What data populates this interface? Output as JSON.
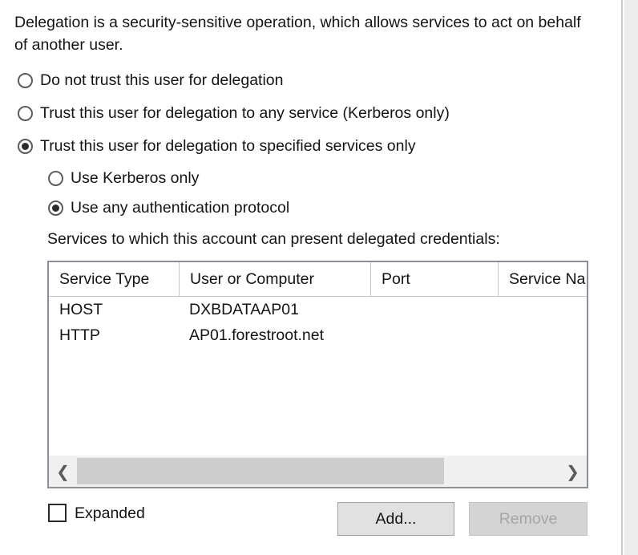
{
  "intro_text": "Delegation is a security-sensitive operation, which allows services to act on behalf of another user.",
  "delegation_options": [
    {
      "label": "Do not trust this user for delegation",
      "checked": false
    },
    {
      "label": "Trust this user for delegation to any service (Kerberos only)",
      "checked": false
    },
    {
      "label": "Trust this user for delegation to specified services only",
      "checked": true
    }
  ],
  "protocol_options": [
    {
      "label": "Use Kerberos only",
      "checked": false
    },
    {
      "label": "Use any authentication protocol",
      "checked": true
    }
  ],
  "list_caption": "Services to which this account can present delegated credentials:",
  "services_table": {
    "columns": [
      "Service Type",
      "User or Computer",
      "Port",
      "Service Na"
    ],
    "rows": [
      {
        "service_type": "HOST",
        "user_or_computer": "DXBDATAAP01",
        "port": "",
        "service_name": ""
      },
      {
        "service_type": "HTTP",
        "user_or_computer": "AP01.forestroot.net",
        "port": "",
        "service_name": ""
      }
    ]
  },
  "scrollbar": {
    "left_arrow": "❮",
    "right_arrow": "❯"
  },
  "expanded_checkbox": {
    "label": "Expanded",
    "checked": false
  },
  "buttons": {
    "add": {
      "label": "Add...",
      "enabled": true
    },
    "remove": {
      "label": "Remove",
      "enabled": false
    }
  },
  "colors": {
    "background": "#ffffff",
    "text": "#141414",
    "listview_border": "#8a8f98",
    "scrollbar_thumb": "#cdcdcd",
    "button_face": "#e1e1e1",
    "disabled_text": "#a6a6a6"
  }
}
